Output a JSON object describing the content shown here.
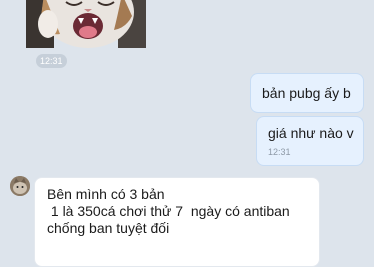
{
  "chat": {
    "sticker": {
      "icon": "cat-sticker-icon",
      "time": "12:31"
    },
    "messages": [
      {
        "direction": "outgoing",
        "text": "bản pubg ấy b"
      },
      {
        "direction": "outgoing",
        "text": "giá như nào v",
        "time": "12:31"
      },
      {
        "direction": "incoming",
        "lines": [
          "Bên mình có 3 bản",
          " 1 là 350cá chơi thử 7  ngày có antiban",
          "chống ban tuyệt đối"
        ]
      }
    ],
    "colors": {
      "background": "#dde4ec",
      "outgoing_bubble": "#e6f1fe",
      "incoming_bubble": "#ffffff"
    }
  }
}
